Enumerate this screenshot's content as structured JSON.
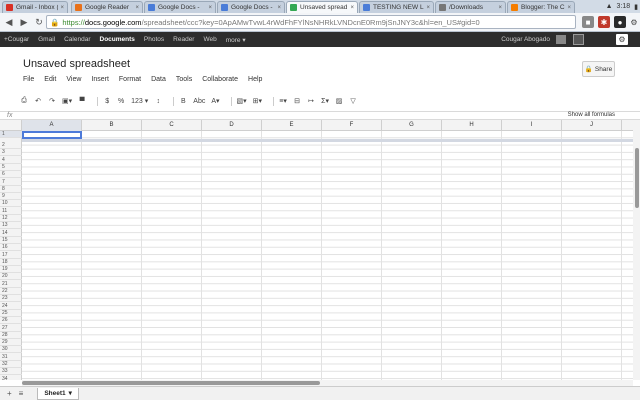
{
  "browser": {
    "tabs": [
      {
        "title": "Gmail - Inbox (3",
        "color": "#d93025"
      },
      {
        "title": "Google Reader",
        "color": "#e8711a"
      },
      {
        "title": "Google Docs -",
        "color": "#4a7cd8"
      },
      {
        "title": "Google Docs -",
        "color": "#4a7cd8"
      },
      {
        "title": "Unsaved spread",
        "color": "#34a853"
      },
      {
        "title": "TESTING NEW L",
        "color": "#4a7cd8"
      },
      {
        "title": "/Downloads",
        "color": "#777777"
      },
      {
        "title": "Blogger: The C",
        "color": "#f57d00"
      }
    ],
    "active_tab": 4,
    "clock": "3:18",
    "url_protocol": "https://",
    "url_host": "docs.google.com",
    "url_path": "/spreadsheet/ccc?key=0ApAMwTvwL4rWdFhFYlNsNHRkLVNDcnE0Rm9jSnJNY3c&hl=en_US#gid=0"
  },
  "gbar": {
    "links": [
      "+Cougar",
      "Gmail",
      "Calendar",
      "Documents",
      "Photos",
      "Reader",
      "Web",
      "more ▾"
    ],
    "active": "Documents",
    "user": "Cougar Abogado"
  },
  "doc": {
    "title": "Unsaved spreadsheet",
    "menu": [
      "File",
      "Edit",
      "View",
      "Insert",
      "Format",
      "Data",
      "Tools",
      "Collaborate",
      "Help"
    ],
    "share_label": "Share"
  },
  "toolbar": {
    "items": [
      "⎙",
      "↶",
      "↷",
      "▣▾",
      "▀",
      "$",
      "%",
      "123 ▾",
      "↕",
      "B",
      "Abc",
      "A▾",
      "▧▾",
      "⊞▾",
      "≡▾",
      "⊟",
      "↦",
      "Σ▾",
      "▨",
      "▽"
    ]
  },
  "formula": {
    "fx_label": "fx",
    "show_all": "Show all formulas"
  },
  "grid": {
    "columns": [
      "A",
      "B",
      "C",
      "D",
      "E",
      "F",
      "G",
      "H",
      "I",
      "J"
    ],
    "rows": [
      "1",
      "2",
      "3",
      "4",
      "5",
      "6",
      "7",
      "8",
      "9",
      "10",
      "11",
      "12",
      "13",
      "14",
      "15",
      "16",
      "17",
      "18",
      "19",
      "20",
      "21",
      "22",
      "23",
      "24",
      "25",
      "26",
      "27",
      "28",
      "29",
      "30",
      "31",
      "32",
      "33",
      "34"
    ],
    "selected_cell": "A1"
  },
  "sheets": {
    "tabs": [
      "Sheet1"
    ]
  }
}
